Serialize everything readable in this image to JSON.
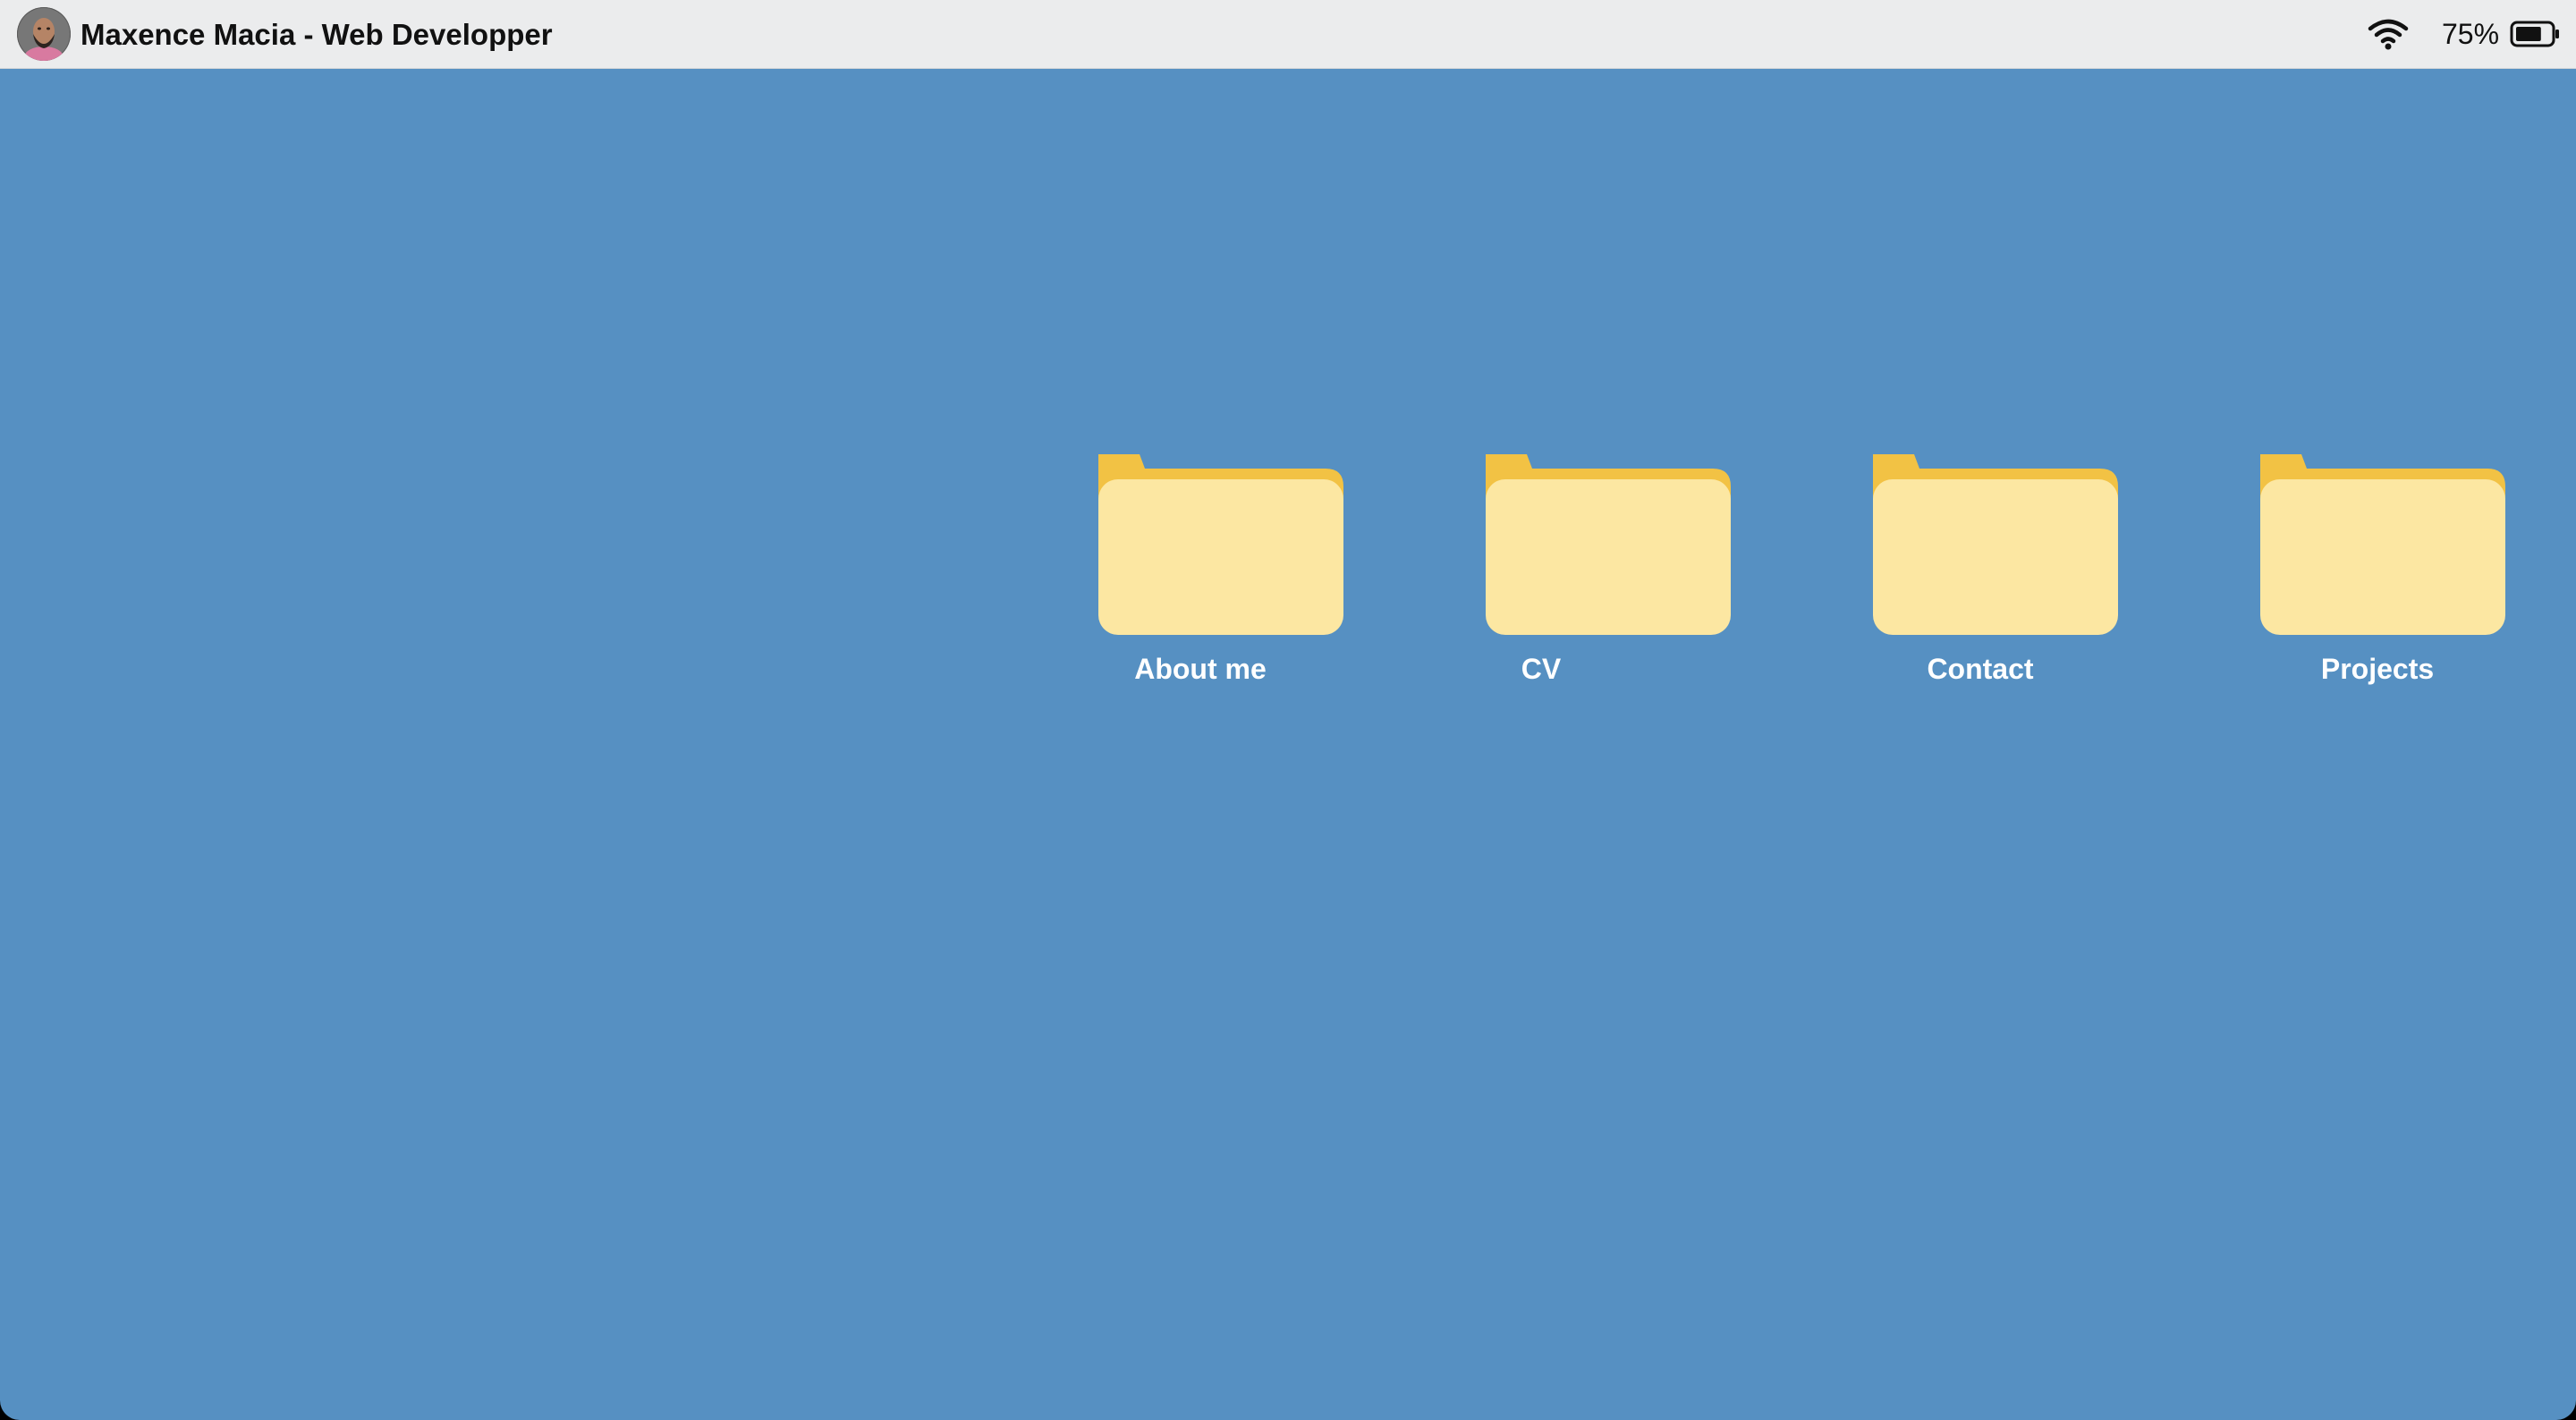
{
  "menubar": {
    "title": "Maxence Macia - Web Developper",
    "avatar_icon": "avatar-photo",
    "wifi_icon": "wifi-icon",
    "battery_percent": "75%",
    "battery_icon": "battery-icon",
    "battery_level": 0.75
  },
  "desktop": {
    "background_color": "#5690c2",
    "folders": [
      {
        "label": "About me",
        "icon": "folder-icon"
      },
      {
        "label": "CV",
        "icon": "folder-icon"
      },
      {
        "label": "Contact",
        "icon": "folder-icon"
      },
      {
        "label": "Projects",
        "icon": "folder-icon"
      }
    ],
    "folder_colors": {
      "back": "#f2c244",
      "front": "#fce7a2"
    }
  }
}
